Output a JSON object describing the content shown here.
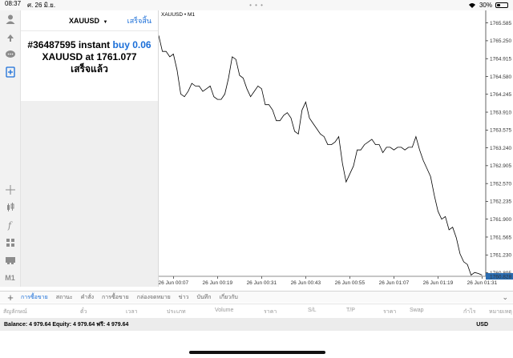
{
  "status": {
    "time": "08:37",
    "date": "ศ. 26 มิ.ย.",
    "dots": "• • •",
    "battery": "30%",
    "battery_level": 0.3
  },
  "toolbar": {
    "m1_label": "M1",
    "icons": [
      "account-icon",
      "trade-icon",
      "chat-icon",
      "new-order-icon",
      "crosshair-icon",
      "candles-icon",
      "indicator-icon",
      "objects-icon",
      "templates-icon",
      "timeframe-icon"
    ]
  },
  "panel": {
    "symbol": "XAUUSD",
    "caret": "▼",
    "done": "เสร็จสิ้น",
    "order_id": "#36487595",
    "order_type": "instant",
    "side_volume": "buy 0.06",
    "fill_text": "XAUUSD at",
    "fill_price": "1761.077",
    "status": "เสร็จแล้ว"
  },
  "chart_data": {
    "type": "line",
    "title": "XAUUSD • M1",
    "ylim": [
      1760.828,
      1765.82
    ],
    "y_ticks": [
      "1765.585",
      "1765.250",
      "1764.915",
      "1764.580",
      "1764.245",
      "1763.910",
      "1763.575",
      "1763.240",
      "1762.905",
      "1762.570",
      "1762.235",
      "1761.900",
      "1761.565",
      "1761.230",
      "1760.895"
    ],
    "current_price": "1760.828",
    "x_ticks": [
      "26 Jun 00:07",
      "26 Jun 00:19",
      "26 Jun 00:31",
      "26 Jun 00:43",
      "26 Jun 00:55",
      "26 Jun 01:07",
      "26 Jun 01:19",
      "26 Jun 01:31"
    ],
    "x_range": [
      "26 Jun 00:03",
      "26 Jun 01:32"
    ],
    "x": [
      "26 Jun 00:03",
      "26 Jun 00:04",
      "26 Jun 00:05",
      "26 Jun 00:06",
      "26 Jun 00:07",
      "26 Jun 00:08",
      "26 Jun 00:09",
      "26 Jun 00:10",
      "26 Jun 00:11",
      "26 Jun 00:12",
      "26 Jun 00:13",
      "26 Jun 00:14",
      "26 Jun 00:15",
      "26 Jun 00:16",
      "26 Jun 00:17",
      "26 Jun 00:18",
      "26 Jun 00:19",
      "26 Jun 00:20",
      "26 Jun 00:21",
      "26 Jun 00:22",
      "26 Jun 00:23",
      "26 Jun 00:24",
      "26 Jun 00:25",
      "26 Jun 00:26",
      "26 Jun 00:27",
      "26 Jun 00:28",
      "26 Jun 00:29",
      "26 Jun 00:30",
      "26 Jun 00:31",
      "26 Jun 00:32",
      "26 Jun 00:33",
      "26 Jun 00:34",
      "26 Jun 00:35",
      "26 Jun 00:36",
      "26 Jun 00:37",
      "26 Jun 00:38",
      "26 Jun 00:39",
      "26 Jun 00:40",
      "26 Jun 00:41",
      "26 Jun 00:42",
      "26 Jun 00:43",
      "26 Jun 00:44",
      "26 Jun 00:45",
      "26 Jun 00:46",
      "26 Jun 00:47",
      "26 Jun 00:48",
      "26 Jun 00:49",
      "26 Jun 00:50",
      "26 Jun 00:51",
      "26 Jun 00:52",
      "26 Jun 00:53",
      "26 Jun 00:54",
      "26 Jun 00:55",
      "26 Jun 00:56",
      "26 Jun 00:57",
      "26 Jun 00:58",
      "26 Jun 00:59",
      "26 Jun 01:00",
      "26 Jun 01:01",
      "26 Jun 01:02",
      "26 Jun 01:03",
      "26 Jun 01:04",
      "26 Jun 01:05",
      "26 Jun 01:06",
      "26 Jun 01:07",
      "26 Jun 01:08",
      "26 Jun 01:09",
      "26 Jun 01:10",
      "26 Jun 01:11",
      "26 Jun 01:12",
      "26 Jun 01:13",
      "26 Jun 01:14",
      "26 Jun 01:15",
      "26 Jun 01:16",
      "26 Jun 01:17",
      "26 Jun 01:18",
      "26 Jun 01:19",
      "26 Jun 01:20",
      "26 Jun 01:21",
      "26 Jun 01:22",
      "26 Jun 01:23",
      "26 Jun 01:24",
      "26 Jun 01:25",
      "26 Jun 01:26",
      "26 Jun 01:27",
      "26 Jun 01:28",
      "26 Jun 01:29",
      "26 Jun 01:30",
      "26 Jun 01:31"
    ],
    "values": [
      1765.35,
      1765.05,
      1765.05,
      1764.95,
      1765.0,
      1764.7,
      1764.25,
      1764.2,
      1764.3,
      1764.45,
      1764.4,
      1764.4,
      1764.3,
      1764.35,
      1764.4,
      1764.2,
      1764.15,
      1764.15,
      1764.25,
      1764.55,
      1764.95,
      1764.9,
      1764.6,
      1764.55,
      1764.35,
      1764.2,
      1764.3,
      1764.4,
      1764.35,
      1764.05,
      1764.05,
      1763.95,
      1763.75,
      1763.75,
      1763.85,
      1763.9,
      1763.8,
      1763.55,
      1763.5,
      1763.95,
      1764.1,
      1763.8,
      1763.7,
      1763.6,
      1763.5,
      1763.45,
      1763.3,
      1763.3,
      1763.35,
      1763.45,
      1762.95,
      1762.6,
      1762.75,
      1762.9,
      1763.2,
      1763.2,
      1763.3,
      1763.35,
      1763.4,
      1763.3,
      1763.3,
      1763.15,
      1763.25,
      1763.25,
      1763.2,
      1763.25,
      1763.25,
      1763.2,
      1763.25,
      1763.25,
      1763.45,
      1763.2,
      1763.0,
      1762.85,
      1762.7,
      1762.35,
      1762.05,
      1761.9,
      1761.95,
      1761.7,
      1761.75,
      1761.55,
      1761.25,
      1761.1,
      1761.05,
      1760.85,
      1760.9,
      1760.88,
      1760.85
    ]
  },
  "tabs": {
    "items": [
      "การซื้อขาย",
      "สถานะ",
      "คำสั่ง",
      "การซื้อขาย",
      "กล่องจดหมาย",
      "ข่าว",
      "บันทึก",
      "เกี่ยวกับ"
    ],
    "plus": "+",
    "more": "⌄"
  },
  "columns": [
    "สัญลักษณ์",
    "ตั๋ว",
    "เวลา",
    "ประเภท",
    "Volume",
    "ราคา",
    "S/L",
    "T/P",
    "ราคา",
    "Swap",
    "กำไร",
    "หมายเหตุ"
  ],
  "balance": {
    "text": "Balance: 4 979.64 Equity: 4 979.64 ฟรี: 4 979.64",
    "currency": "USD"
  },
  "colors": {
    "accent": "#1a6ed8",
    "price_label_bg": "#2b6cb0"
  }
}
